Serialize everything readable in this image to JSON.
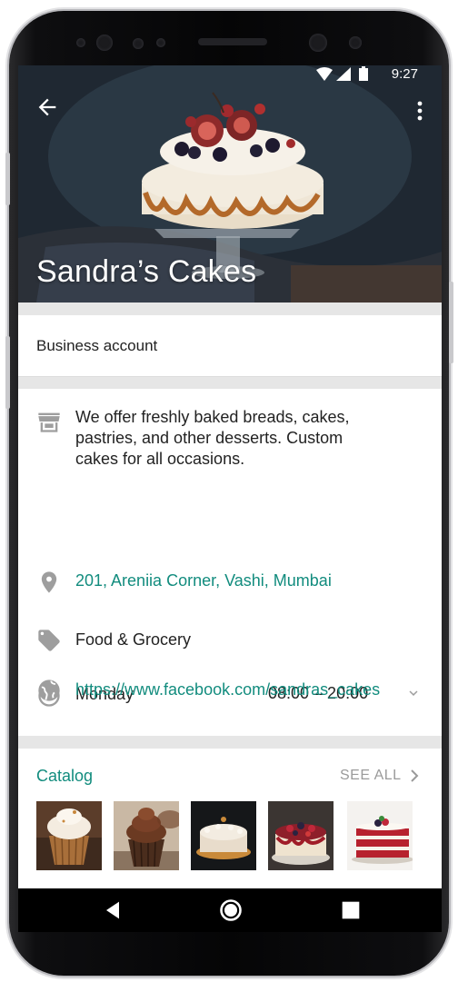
{
  "status_bar": {
    "time": "9:27"
  },
  "header": {
    "title": "Sandra’s Cakes"
  },
  "account": {
    "label": "Business account"
  },
  "info": {
    "description": "We offer freshly baked breads, cakes, pastries, and other desserts. Custom cakes for all occasions.",
    "address": "201, Areniia Corner, Vashi, Mumbai",
    "category": "Food & Grocery",
    "hours_day": "Monday",
    "hours_time": "08:00 – 20:00",
    "website": "https://www.facebook.com/sandras_cakes"
  },
  "catalog": {
    "title": "Catalog",
    "see_all": "SEE ALL",
    "items": [
      "cupcake-vanilla",
      "cupcake-chocolate",
      "cream-cake",
      "berry-cheesecake",
      "red-velvet-cake"
    ]
  },
  "colors": {
    "accent": "#128c7e",
    "icon_gray": "#9e9e9e",
    "header_dark": "#25303c"
  },
  "icons": {
    "back": "arrow-left-icon",
    "more": "more-vertical-icon",
    "store": "store-icon",
    "location": "location-pin-icon",
    "tag": "tag-icon",
    "clock": "clock-icon",
    "globe": "globe-icon",
    "chevron_down": "chevron-down-icon",
    "chevron_right": "chevron-right-icon"
  }
}
